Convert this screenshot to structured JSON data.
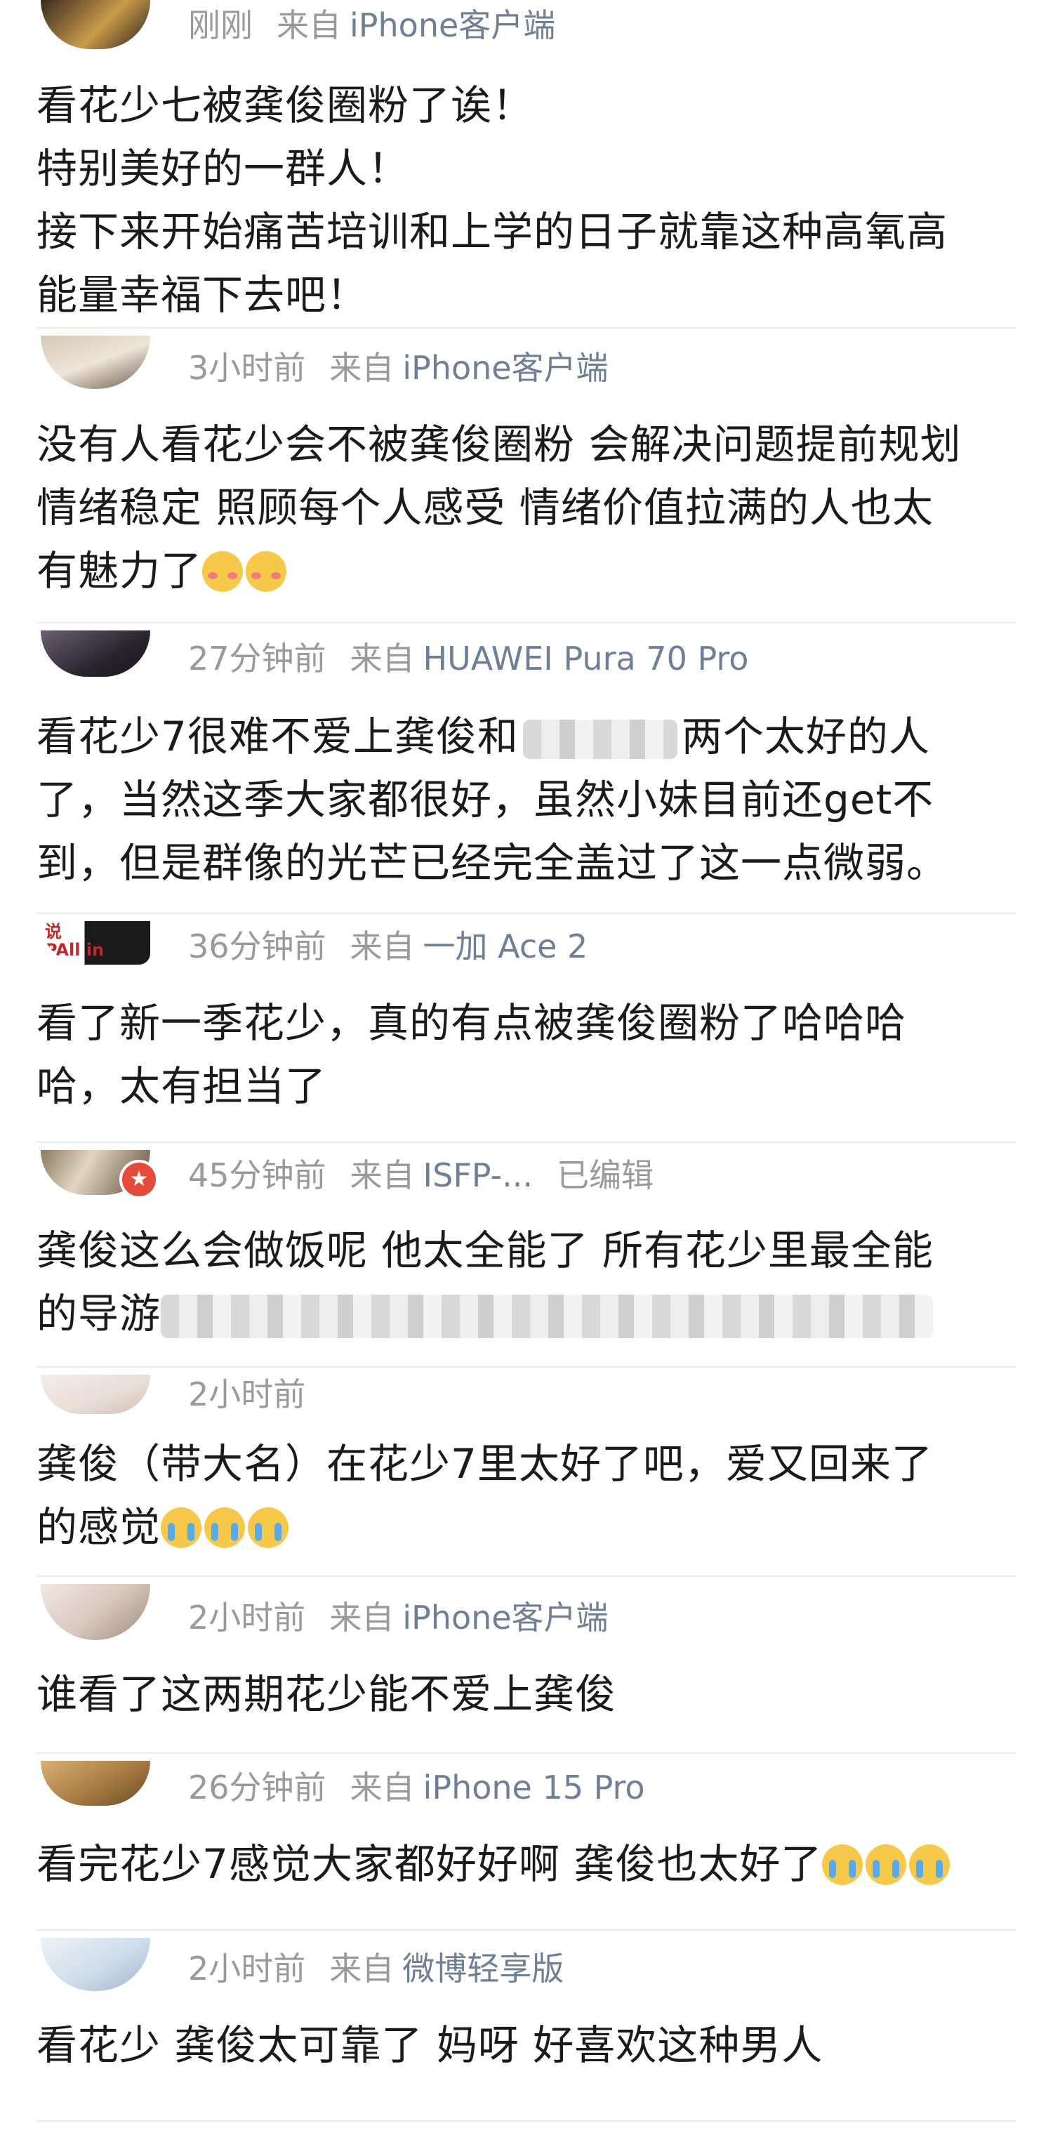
{
  "comments": [
    {
      "time": "刚刚",
      "src_label": "来自",
      "source": "iPhone客户端",
      "edited": "",
      "lines": [
        "看花少七被龚俊圈粉了诶！",
        "特别美好的一群人！",
        "接下来开始痛苦培训和上学的日子就靠这种高氧高",
        "能量幸福下去吧！"
      ],
      "avatar_color": "#b48a4a"
    },
    {
      "time": "3小时前",
      "src_label": "来自",
      "source": "iPhone客户端",
      "edited": "",
      "lines": [
        "没有人看花少会不被龚俊圈粉 会解决问题提前规划",
        "情绪稳定 照顾每个人感受 情绪价值拉满的人也太",
        "有魅力了"
      ],
      "avatar_color": "#c9b9a8"
    },
    {
      "time": "27分钟前",
      "src_label": "来自",
      "source": "HUAWEI Pura 70 Pro",
      "edited": "",
      "lines": [
        "看花少7很难不爱上龚俊和",
        "两个太好的人",
        "了，当然这季大家都很好，虽然小妹目前还get不",
        "到，但是群像的光芒已经完全盖过了这一点微弱。"
      ],
      "avatar_color": "#3a3340"
    },
    {
      "time": "36分钟前",
      "src_label": "来自",
      "source": "一加 Ace 2",
      "edited": "",
      "lines": [
        "看了新一季花少，真的有点被龚俊圈粉了哈哈哈",
        "哈，太有担当了"
      ],
      "avatar_color": "#1d1d1d",
      "avatar_text": "说\nPAll in"
    },
    {
      "time": "45分钟前",
      "src_label": "来自",
      "source": "ISFP-...",
      "edited": "已编辑",
      "lines": [
        "龚俊这么会做饭呢 他太全能了 所有花少里最全能",
        "的导游"
      ],
      "avatar_color": "#d8cbb6"
    },
    {
      "time": "2小时前",
      "src_label": "",
      "source": "",
      "edited": "",
      "lines": [
        "龚俊（带大名）在花少7里太好了吧，爱又回来了",
        "的感觉"
      ],
      "avatar_color": "#f0e6e2"
    },
    {
      "time": "2小时前",
      "src_label": "来自",
      "source": "iPhone客户端",
      "edited": "",
      "lines": [
        "谁看了这两期花少能不爱上龚俊"
      ],
      "avatar_color": "#e8ded8"
    },
    {
      "time": "26分钟前",
      "src_label": "来自",
      "source": "iPhone 15 Pro",
      "edited": "",
      "lines": [
        "看完花少7感觉大家都好好啊 龚俊也太好了"
      ],
      "avatar_color": "#c79a5e"
    },
    {
      "time": "2小时前",
      "src_label": "来自",
      "source": "微博轻享版",
      "edited": "",
      "lines": [
        "看花少 龚俊太可靠了 妈呀 好喜欢这种男人"
      ],
      "avatar_color": "#dfe8f2"
    }
  ],
  "icons": {
    "avatar": "avatar-image",
    "vip_badge": "vip-badge-icon",
    "emoji_cry": "crying-emoji-icon",
    "emoji_blush": "blushing-emoji-icon"
  }
}
